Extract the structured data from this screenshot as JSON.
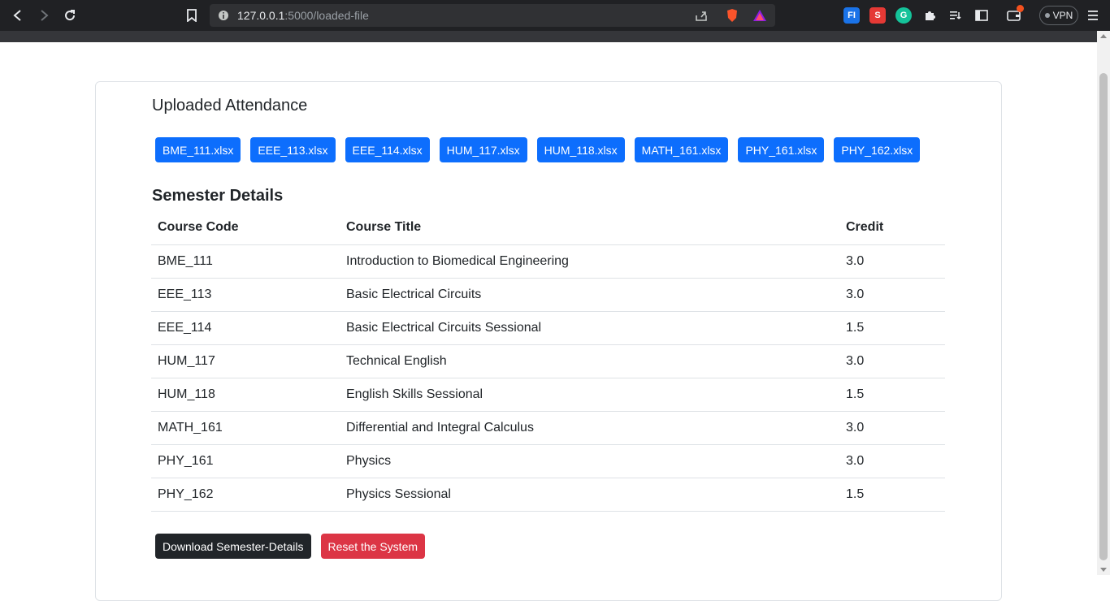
{
  "browser": {
    "url_host": "127.0.0.1",
    "url_rest": ":5000/loaded-file",
    "vpn_label": "VPN",
    "extensions": [
      {
        "name": "fi-extension",
        "label": "FI",
        "color": "#1a73e8"
      },
      {
        "name": "s-extension",
        "label": "S",
        "color": "#e53935"
      },
      {
        "name": "grammarly-extension",
        "label": "G",
        "color": "#15c39a"
      }
    ]
  },
  "attendance": {
    "heading": "Uploaded Attendance",
    "files": [
      "BME_111.xlsx",
      "EEE_113.xlsx",
      "EEE_114.xlsx",
      "HUM_117.xlsx",
      "HUM_118.xlsx",
      "MATH_161.xlsx",
      "PHY_161.xlsx",
      "PHY_162.xlsx"
    ]
  },
  "semester": {
    "heading": "Semester Details",
    "columns": [
      "Course Code",
      "Course Title",
      "Credit"
    ],
    "rows": [
      [
        "BME_111",
        "Introduction to Biomedical Engineering",
        "3.0"
      ],
      [
        "EEE_113",
        "Basic Electrical Circuits",
        "3.0"
      ],
      [
        "EEE_114",
        "Basic Electrical Circuits Sessional",
        "1.5"
      ],
      [
        "HUM_117",
        "Technical English",
        "3.0"
      ],
      [
        "HUM_118",
        "English Skills Sessional",
        "1.5"
      ],
      [
        "MATH_161",
        "Differential and Integral Calculus",
        "3.0"
      ],
      [
        "PHY_161",
        "Physics",
        "3.0"
      ],
      [
        "PHY_162",
        "Physics Sessional",
        "1.5"
      ]
    ]
  },
  "actions": {
    "download_label": "Download Semester-Details",
    "reset_label": "Reset the System"
  },
  "colors": {
    "primary": "#0d6efd",
    "dark": "#212529",
    "danger": "#dc3545"
  }
}
